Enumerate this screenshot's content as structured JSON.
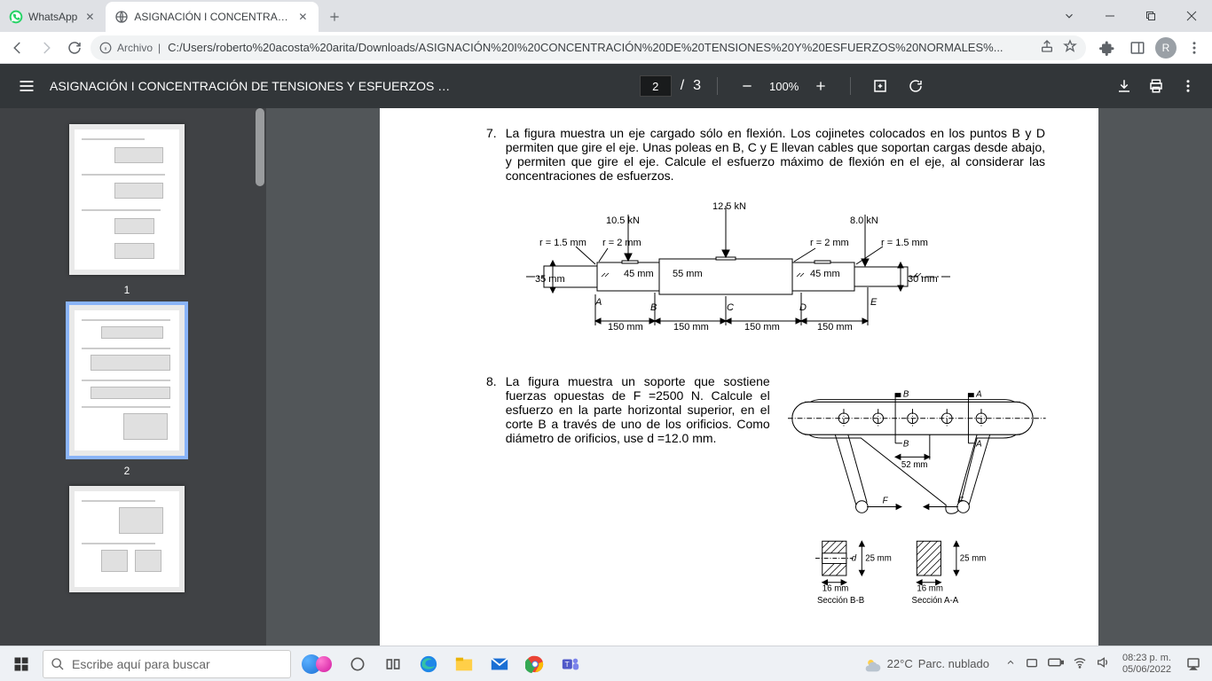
{
  "browser": {
    "tabs": [
      {
        "title": "WhatsApp",
        "favicon": "whatsapp",
        "active": false
      },
      {
        "title": "ASIGNACIÓN I CONCENTRACIÓN",
        "favicon": "globe",
        "active": true
      }
    ],
    "url_prefix_label": "Archivo",
    "url_path": "C:/Users/roberto%20acosta%20arita/Downloads/ASIGNACIÓN%20I%20CONCENTRACIÓN%20DE%20TENSIONES%20Y%20ESFUERZOS%20NORMALES%...",
    "avatar_letter": "R"
  },
  "pdf": {
    "title": "ASIGNACIÓN I CONCENTRACIÓN DE TENSIONES Y ESFUERZOS NOR...",
    "page_current": "2",
    "page_sep": "/",
    "page_total": "3",
    "zoom": "100%",
    "thumbs": [
      {
        "num": "1",
        "active": false
      },
      {
        "num": "2",
        "active": true
      },
      {
        "num": "3",
        "active": false
      }
    ]
  },
  "content": {
    "p7": {
      "num": "7.",
      "text": "La figura muestra un eje cargado sólo en flexión. Los cojinetes colocados en los puntos B y D permiten que gire el eje. Unas poleas en B, C y E llevan cables que soportan cargas desde abajo, y permiten que gire el eje. Calcule el esfuerzo máximo de flexión en el eje, al considerar las concentraciones de esfuerzos."
    },
    "p8": {
      "num": "8.",
      "text": "La figura muestra un soporte que sostiene fuerzas opuestas de F =2500 N. Calcule el esfuerzo en la parte horizontal superior, en el corte B a través de uno de los orificios. Como diámetro de orificios, use d =12.0 mm."
    },
    "fig7": {
      "loads": {
        "B": "10.5 kN",
        "C": "12.5 kN",
        "E": "8.0 kN"
      },
      "fillets": {
        "rA": "r = 1.5 mm",
        "rB": "r = 2 mm",
        "rD": "r = 2 mm",
        "rE": "r = 1.5 mm"
      },
      "dia": {
        "A": "35 mm",
        "B": "45 mm",
        "C": "55 mm",
        "D": "45 mm",
        "E": "30 mm"
      },
      "pts": {
        "A": "A",
        "B": "B",
        "C": "C",
        "D": "D",
        "E": "E"
      },
      "spans": {
        "s1": "150 mm",
        "s2": "150 mm",
        "s3": "150 mm",
        "s4": "150 mm"
      }
    },
    "fig8": {
      "lblA": "A",
      "lblB": "B",
      "lblF": "F",
      "dim52": "52 mm",
      "secA_w": "16 mm",
      "secA_h": "25 mm",
      "secB_w": "16 mm",
      "secB_h": "25 mm",
      "secB_d": "d",
      "secA_cap": "Sección A-A",
      "secB_cap": "Sección B-B"
    }
  },
  "taskbar": {
    "search_placeholder": "Escribe aquí para buscar",
    "weather_temp": "22°C",
    "weather_cond": "Parc. nublado",
    "time": "08:23 p. m.",
    "date": "05/06/2022"
  }
}
